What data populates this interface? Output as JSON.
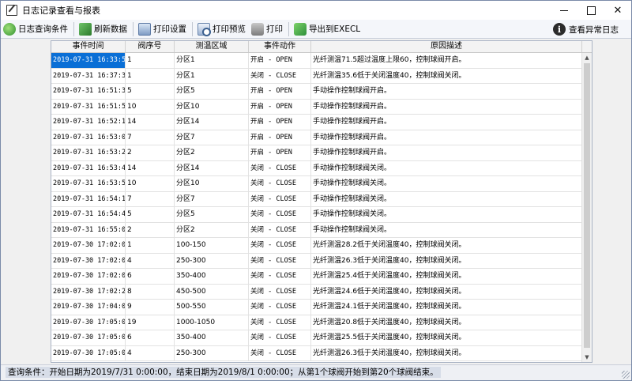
{
  "window": {
    "title": "日志记录查看与报表"
  },
  "toolbar": {
    "items": [
      {
        "label": "日志查询条件",
        "icon": "search-filter-icon"
      },
      {
        "label": "刷新数据",
        "icon": "refresh-icon"
      },
      {
        "label": "打印设置",
        "icon": "print-setup-icon"
      },
      {
        "label": "打印预览",
        "icon": "print-preview-icon"
      },
      {
        "label": "打印",
        "icon": "printer-icon"
      },
      {
        "label": "导出到EXECL",
        "icon": "export-excel-icon"
      }
    ],
    "right_label": "查看异常日志",
    "right_icon": "info-icon"
  },
  "grid": {
    "columns": [
      "事件时间",
      "阀序号",
      "测温区域",
      "事件动作",
      "原因描述"
    ],
    "selected_row": 0,
    "rows": [
      [
        "2019-07-31 16:33:58",
        "1",
        "分区1",
        "开启 - OPEN",
        "光纤测温71.5超过温度上限60，控制球阀开启。"
      ],
      [
        "2019-07-31 16:37:34",
        "1",
        "分区1",
        "关闭 - CLOSE",
        "光纤测温35.6低于关闭温度40，控制球阀关闭。"
      ],
      [
        "2019-07-31 16:51:37",
        "5",
        "分区5",
        "开启 - OPEN",
        "手动操作控制球阀开启。"
      ],
      [
        "2019-07-31 16:51:59",
        "10",
        "分区10",
        "开启 - OPEN",
        "手动操作控制球阀开启。"
      ],
      [
        "2019-07-31 16:52:18",
        "14",
        "分区14",
        "开启 - OPEN",
        "手动操作控制球阀开启。"
      ],
      [
        "2019-07-31 16:53:03",
        "7",
        "分区7",
        "开启 - OPEN",
        "手动操作控制球阀开启。"
      ],
      [
        "2019-07-31 16:53:20",
        "2",
        "分区2",
        "开启 - OPEN",
        "手动操作控制球阀开启。"
      ],
      [
        "2019-07-31 16:53:42",
        "14",
        "分区14",
        "关闭 - CLOSE",
        "手动操作控制球阀关闭。"
      ],
      [
        "2019-07-31 16:53:57",
        "10",
        "分区10",
        "关闭 - CLOSE",
        "手动操作控制球阀关闭。"
      ],
      [
        "2019-07-31 16:54:13",
        "7",
        "分区7",
        "关闭 - CLOSE",
        "手动操作控制球阀关闭。"
      ],
      [
        "2019-07-31 16:54:44",
        "5",
        "分区5",
        "关闭 - CLOSE",
        "手动操作控制球阀关闭。"
      ],
      [
        "2019-07-31 16:55:07",
        "2",
        "分区2",
        "关闭 - CLOSE",
        "手动操作控制球阀关闭。"
      ],
      [
        "2019-07-30 17:02:03",
        "1",
        "100-150",
        "关闭 - CLOSE",
        "光纤测温28.2低于关闭温度40，控制球阀关闭。"
      ],
      [
        "2019-07-30 17:02:03",
        "4",
        "250-300",
        "关闭 - CLOSE",
        "光纤测温26.3低于关闭温度40，控制球阀关闭。"
      ],
      [
        "2019-07-30 17:02:03",
        "6",
        "350-400",
        "关闭 - CLOSE",
        "光纤测温25.4低于关闭温度40，控制球阀关闭。"
      ],
      [
        "2019-07-30 17:02:21",
        "8",
        "450-500",
        "关闭 - CLOSE",
        "光纤测温24.6低于关闭温度40，控制球阀关闭。"
      ],
      [
        "2019-07-30 17:04:02",
        "9",
        "500-550",
        "关闭 - CLOSE",
        "光纤测温24.1低于关闭温度40，控制球阀关闭。"
      ],
      [
        "2019-07-30 17:05:00",
        "19",
        "1000-1050",
        "关闭 - CLOSE",
        "光纤测温20.8低于关闭温度40，控制球阀关闭。"
      ],
      [
        "2019-07-30 17:05:00",
        "6",
        "350-400",
        "关闭 - CLOSE",
        "光纤测温25.5低于关闭温度40，控制球阀关闭。"
      ],
      [
        "2019-07-30 17:05:00",
        "4",
        "250-300",
        "关闭 - CLOSE",
        "光纤测温26.3低于关闭温度40，控制球阀关闭。"
      ]
    ]
  },
  "statusbar": {
    "text": "查询条件：开始日期为2019/7/31 0:00:00，结束日期为2019/8/1 0:00:00；从第1个球阀开始到第20个球阀结束。"
  }
}
